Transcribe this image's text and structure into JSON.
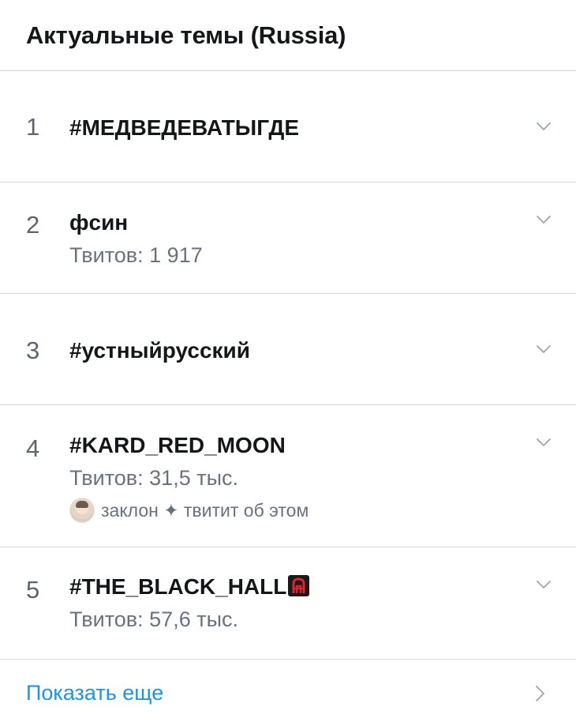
{
  "header": {
    "title": "Актуальные темы (Russia)"
  },
  "trends": [
    {
      "rank": "1",
      "topic": "#МЕДВЕДЕВАТЫГДЕ"
    },
    {
      "rank": "2",
      "topic": "фсин",
      "count": "Твитов: 1 917"
    },
    {
      "rank": "3",
      "topic": "#устныйрусский"
    },
    {
      "rank": "4",
      "topic": "#KARD_RED_MOON",
      "count": "Твитов: 31,5 тыс.",
      "social": "заклон ✦ твитит об этом"
    },
    {
      "rank": "5",
      "topic": "#THE_BLACK_HALL",
      "count": "Твитов: 57,6 тыс.",
      "emoji": "red-a-emoji"
    }
  ],
  "show_more": {
    "label": "Показать еще"
  },
  "colors": {
    "accent": "#1b95e0",
    "text_primary": "#14171a",
    "text_secondary": "#66727f",
    "divider": "#d4d8dc"
  },
  "icons": {
    "expand": "chevron-down-icon",
    "more": "chevron-right-icon"
  }
}
